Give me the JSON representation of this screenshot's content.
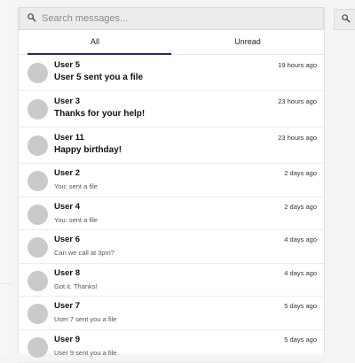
{
  "search": {
    "placeholder": "Search messages...",
    "icon": "search-icon"
  },
  "tabs": [
    {
      "label": "All",
      "active": true
    },
    {
      "label": "Unread",
      "active": false
    }
  ],
  "messages": [
    {
      "user": "User 5",
      "time": "19 hours ago",
      "preview": "User 5 sent you a file",
      "unread": true
    },
    {
      "user": "User 3",
      "time": "23 hours ago",
      "preview": "Thanks for your help!",
      "unread": true
    },
    {
      "user": "User 11",
      "time": "23 hours ago",
      "preview": "Happy birthday!",
      "unread": true
    },
    {
      "user": "User 2",
      "time": "2 days ago",
      "preview": "You: sent a file",
      "unread": false
    },
    {
      "user": "User 4",
      "time": "2 days ago",
      "preview": "You: sent a file",
      "unread": false
    },
    {
      "user": "User 6",
      "time": "4 days ago",
      "preview": "Can we call at 3pm?",
      "unread": false
    },
    {
      "user": "User 8",
      "time": "4 days ago",
      "preview": "Got it. Thanks!",
      "unread": false
    },
    {
      "user": "User 7",
      "time": "5 days ago",
      "preview": "User 7 sent you a file",
      "unread": false
    },
    {
      "user": "User 9",
      "time": "5 days ago",
      "preview": "User 9 sent you a file",
      "unread": false
    }
  ],
  "colors": {
    "accent": "#1f2a70",
    "avatar": "#cacaca"
  },
  "right_button": {
    "icon": "search-icon"
  }
}
